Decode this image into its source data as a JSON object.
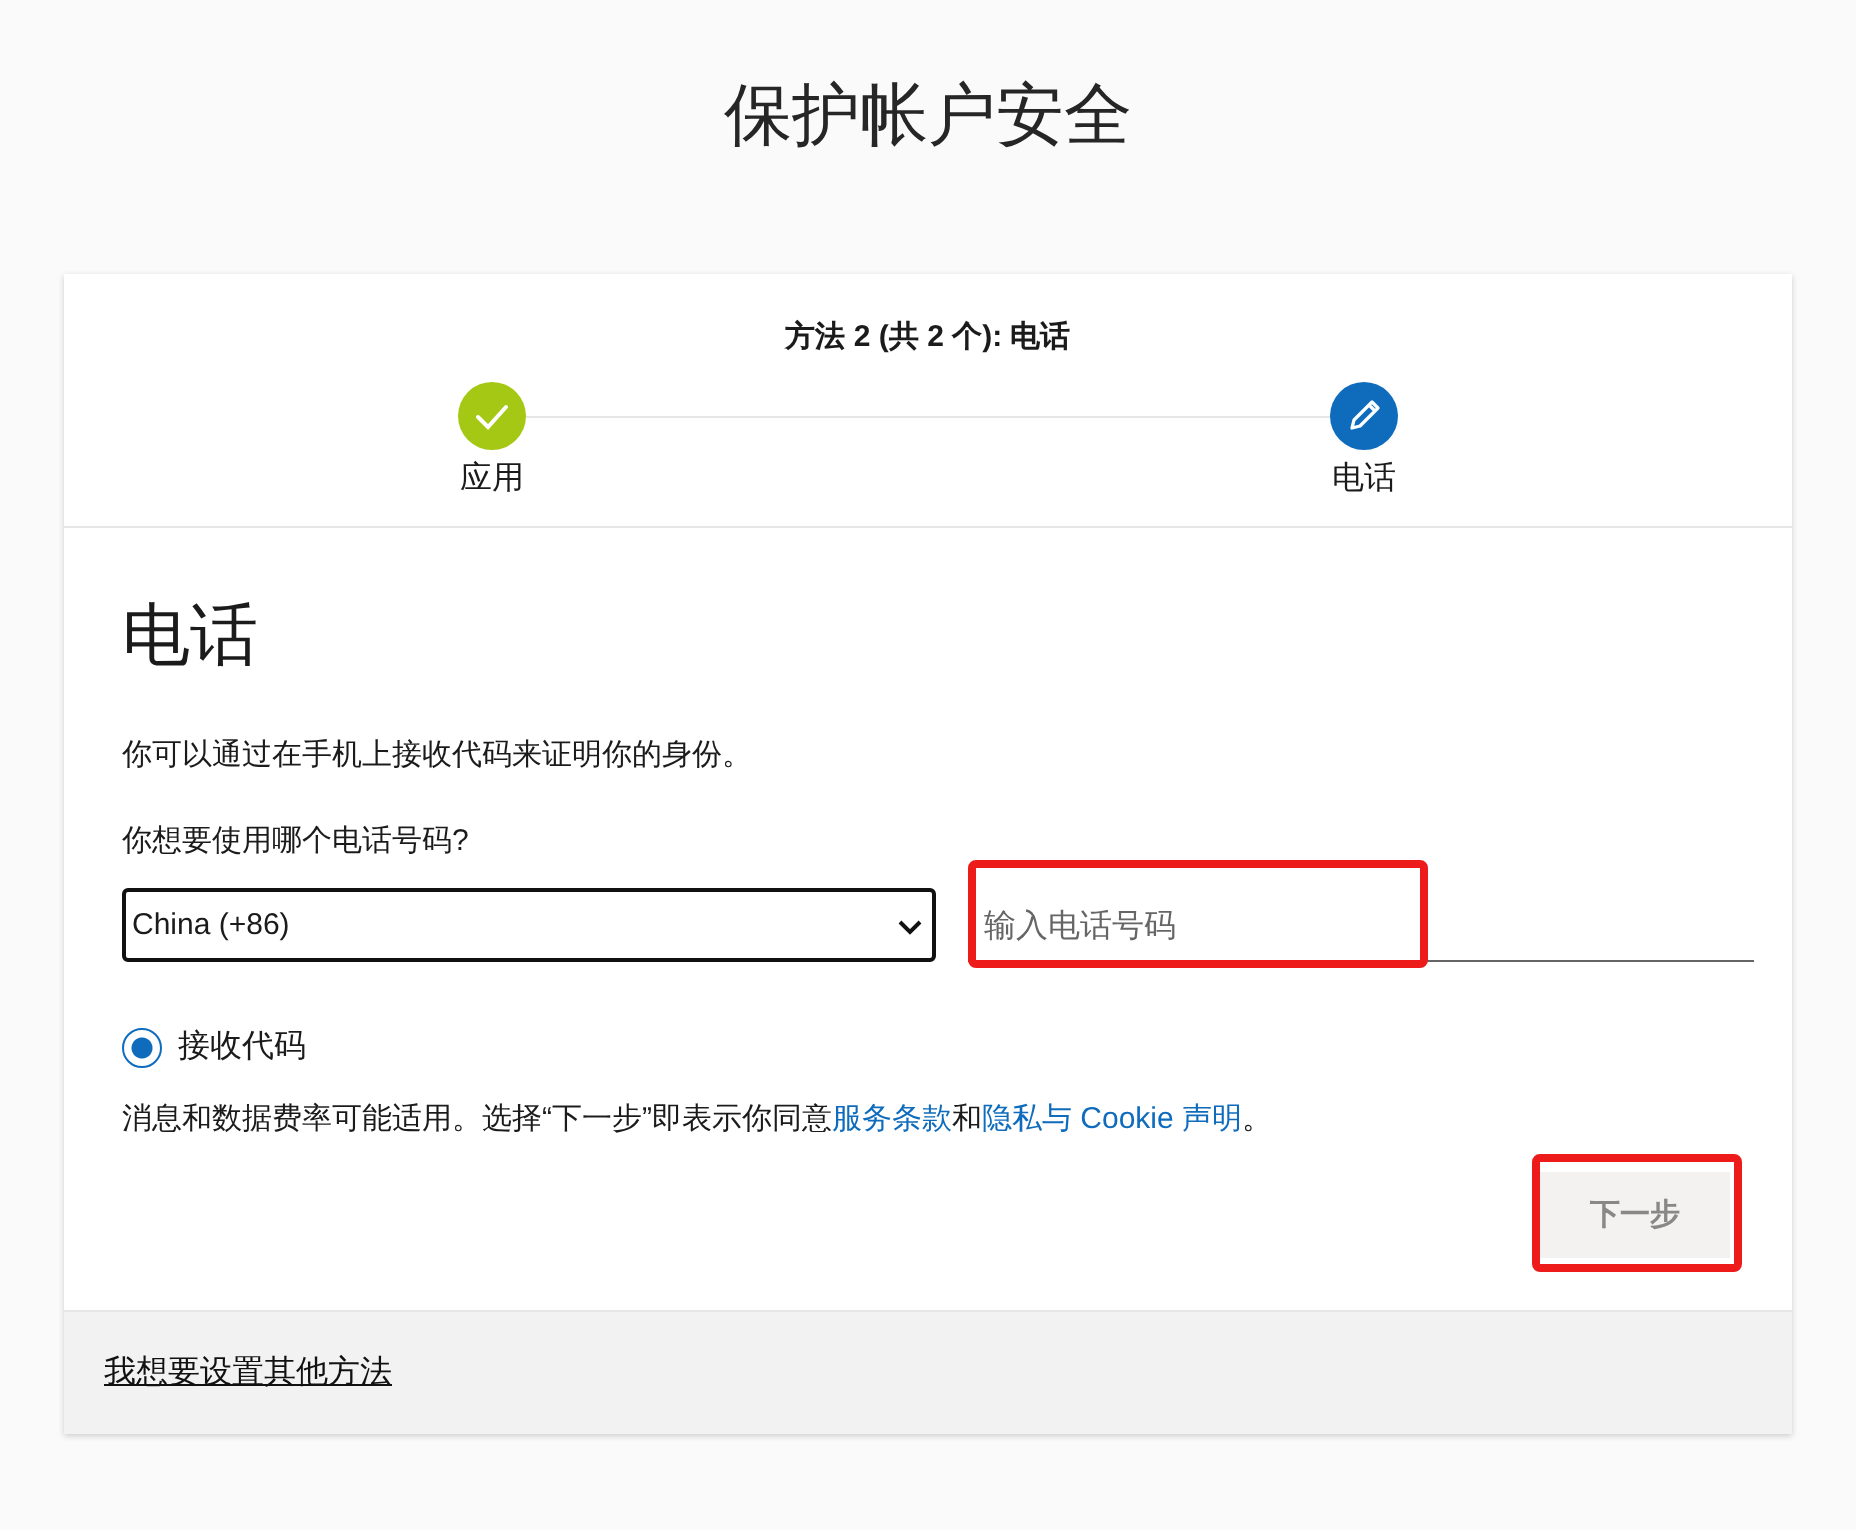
{
  "page_title": "保护帐户安全",
  "progress": {
    "title": "方法 2 (共 2 个): 电话",
    "steps": [
      {
        "label": "应用",
        "kind": "done"
      },
      {
        "label": "电话",
        "kind": "current"
      }
    ]
  },
  "section": {
    "heading": "电话",
    "description": "你可以通过在手机上接收代码来证明你的身份。",
    "question": "你想要使用哪个电话号码?",
    "country_select": {
      "value": "China (+86)"
    },
    "phone_field": {
      "placeholder": "输入电话号码",
      "highlighted": true
    },
    "options": [
      {
        "label": "接收代码",
        "selected": true
      }
    ],
    "notice": [
      {
        "kind": "text",
        "text": "消息和数据费率可能适用。选择“下一步”即表示你同意"
      },
      {
        "kind": "link",
        "text": "服务条款"
      },
      {
        "kind": "text",
        "text": "和"
      },
      {
        "kind": "link",
        "text": "隐私与 Cookie 声明"
      },
      {
        "kind": "text",
        "text": "。"
      }
    ],
    "next_button": {
      "label": "下一步",
      "disabled": true,
      "highlighted": true
    }
  },
  "footer": {
    "link": "我想要设置其他方法"
  }
}
